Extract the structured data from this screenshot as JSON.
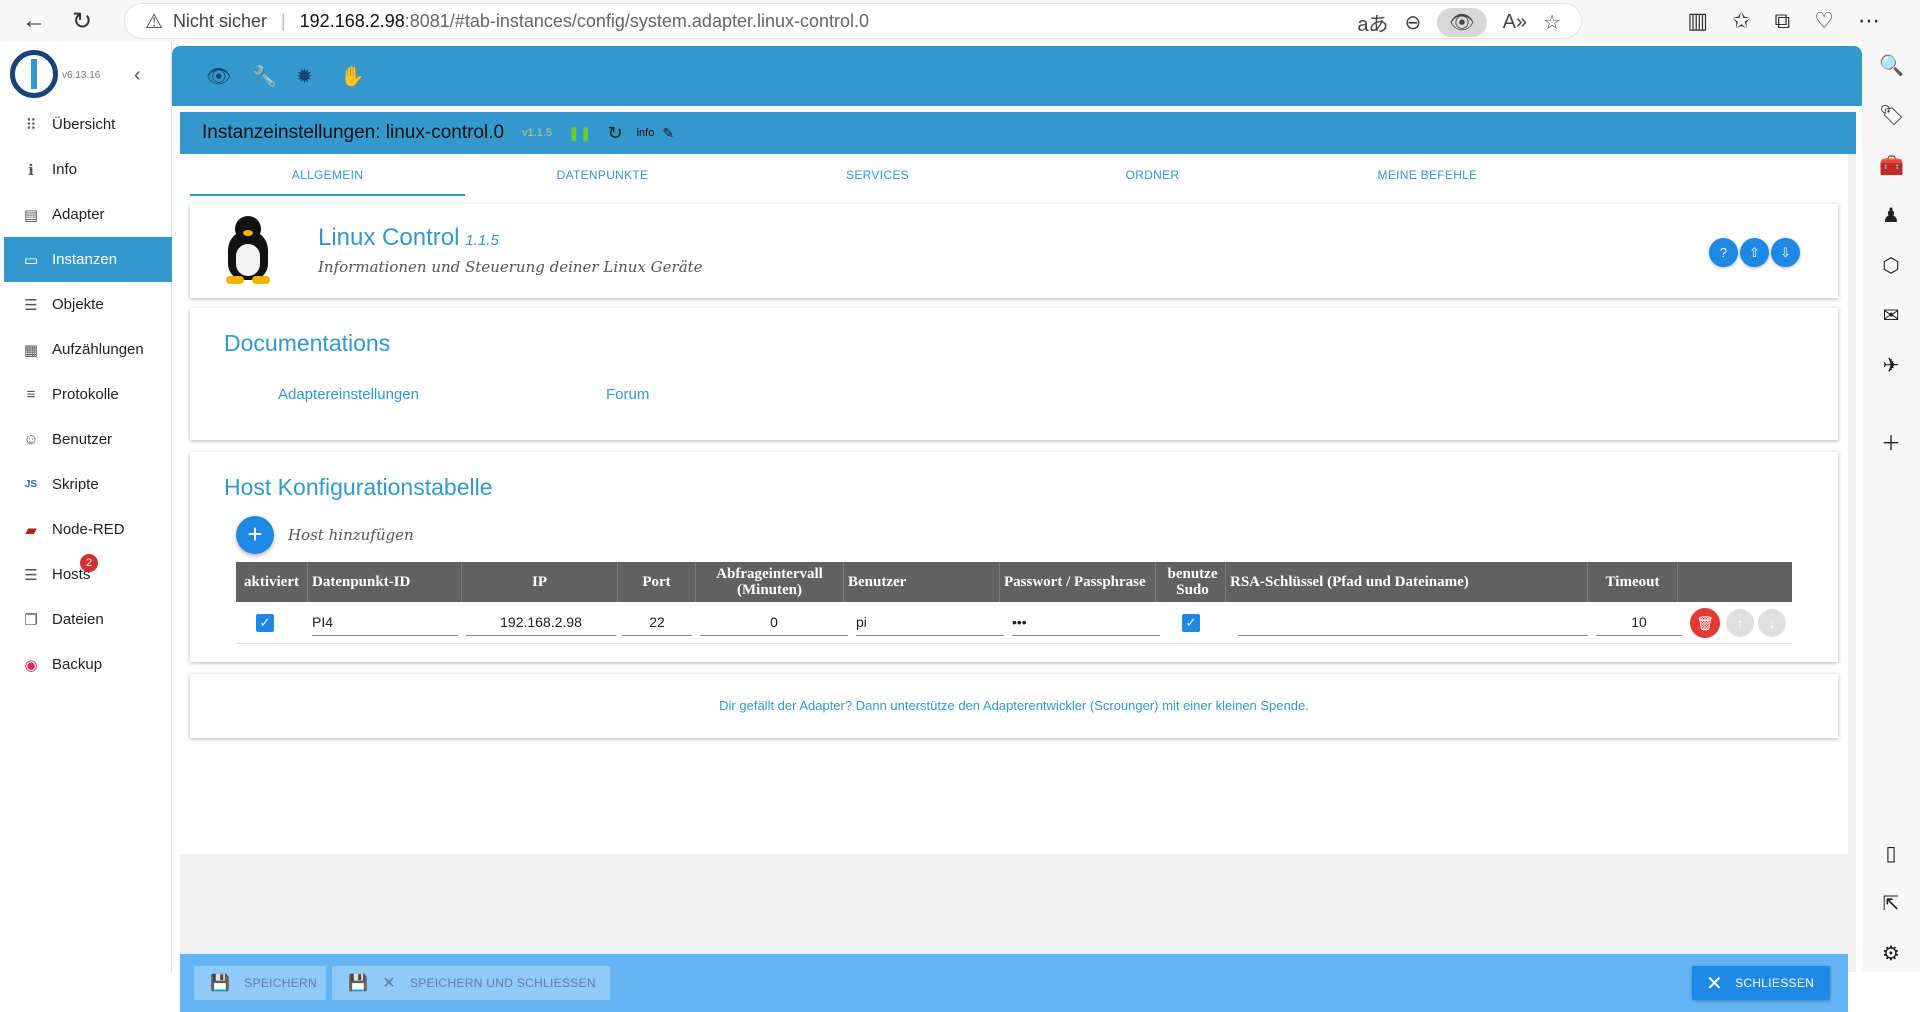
{
  "browser": {
    "back_icon": "←",
    "reload_icon": "↻",
    "insecure_label": "Nicht sicher",
    "url_host": "192.168.2.98",
    "url_rest": ":8081/#tab-instances/config/system.adapter.linux-control.0",
    "addr_icons": [
      "aあ",
      "⊖",
      "👁",
      "A»",
      "☆"
    ],
    "right_icons": [
      "▥",
      "✩",
      "⧉",
      "♡",
      "⋯"
    ]
  },
  "edge_icons": [
    "🔍",
    "🏷",
    "🧰",
    "♟",
    "⬡",
    "✉",
    "✈",
    "＋",
    "▯",
    "⇱",
    "⚙"
  ],
  "app": {
    "version": "v6.13.16",
    "collapse_icon": "‹",
    "nav": [
      {
        "label": "Übersicht",
        "icon": "⠿"
      },
      {
        "label": "Info",
        "icon": "ℹ"
      },
      {
        "label": "Adapter",
        "icon": "▤"
      },
      {
        "label": "Instanzen",
        "icon": "▭"
      },
      {
        "label": "Objekte",
        "icon": "☰"
      },
      {
        "label": "Aufzählungen",
        "icon": "▦"
      },
      {
        "label": "Protokolle",
        "icon": "≡"
      },
      {
        "label": "Benutzer",
        "icon": "☺"
      },
      {
        "label": "Skripte",
        "icon": "JS"
      },
      {
        "label": "Node-RED",
        "icon": "▰"
      },
      {
        "label": "Hosts",
        "icon": "☰",
        "badge": "2"
      },
      {
        "label": "Dateien",
        "icon": "❐"
      },
      {
        "label": "Backup",
        "icon": "◉"
      }
    ],
    "top_icons": [
      "👁",
      "🔧",
      "✹",
      "✋"
    ]
  },
  "instance": {
    "title": "Instanzeinstellungen: linux-control.0",
    "version": "v1.1.5",
    "pause_icon": "❚❚",
    "reload_icon": "↻",
    "info_label": "info",
    "edit_icon": "✎"
  },
  "tabs": [
    "ALLGEMEIN",
    "DATENPUNKTE",
    "SERVICES",
    "ORDNER",
    "MEINE BEFEHLE"
  ],
  "adapter": {
    "name": "Linux Control",
    "version": "1.1.5",
    "description": "Informationen und Steuerung deiner Linux Geräte",
    "buttons": [
      "?",
      "⇧",
      "⇩"
    ]
  },
  "docs": {
    "title": "Documentations",
    "links": [
      "Adaptereinstellungen",
      "Forum"
    ]
  },
  "hosts": {
    "title": "Host Konfigurationstabelle",
    "add_label": "Host hinzufügen",
    "columns": [
      "aktiviert",
      "Datenpunkt-ID",
      "IP",
      "Port",
      "Abfrageintervall (Minuten)",
      "Benutzer",
      "Passwort / Passphrase",
      "benutze Sudo",
      "RSA-Schlüssel (Pfad und Dateiname)",
      "Timeout",
      ""
    ],
    "rows": [
      {
        "enabled": true,
        "id": "PI4",
        "ip": "192.168.2.98",
        "port": "22",
        "interval": "0",
        "user": "pi",
        "password": "•••",
        "sudo": true,
        "rsa": "",
        "timeout": "10"
      }
    ]
  },
  "donate": "Dir gefällt der Adapter? Dann unterstütze den Adapterentwickler (Scrounger) mit einer kleinen Spende.",
  "footer": {
    "save": "SPEICHERN",
    "save_close": "SPEICHERN UND SCHLIESSEN",
    "close": "SCHLIESSEN"
  },
  "colors": {
    "accent": "#3399cc",
    "primary_button": "#1e88e5",
    "delete": "#e53935",
    "footer": "#64b5f6"
  }
}
